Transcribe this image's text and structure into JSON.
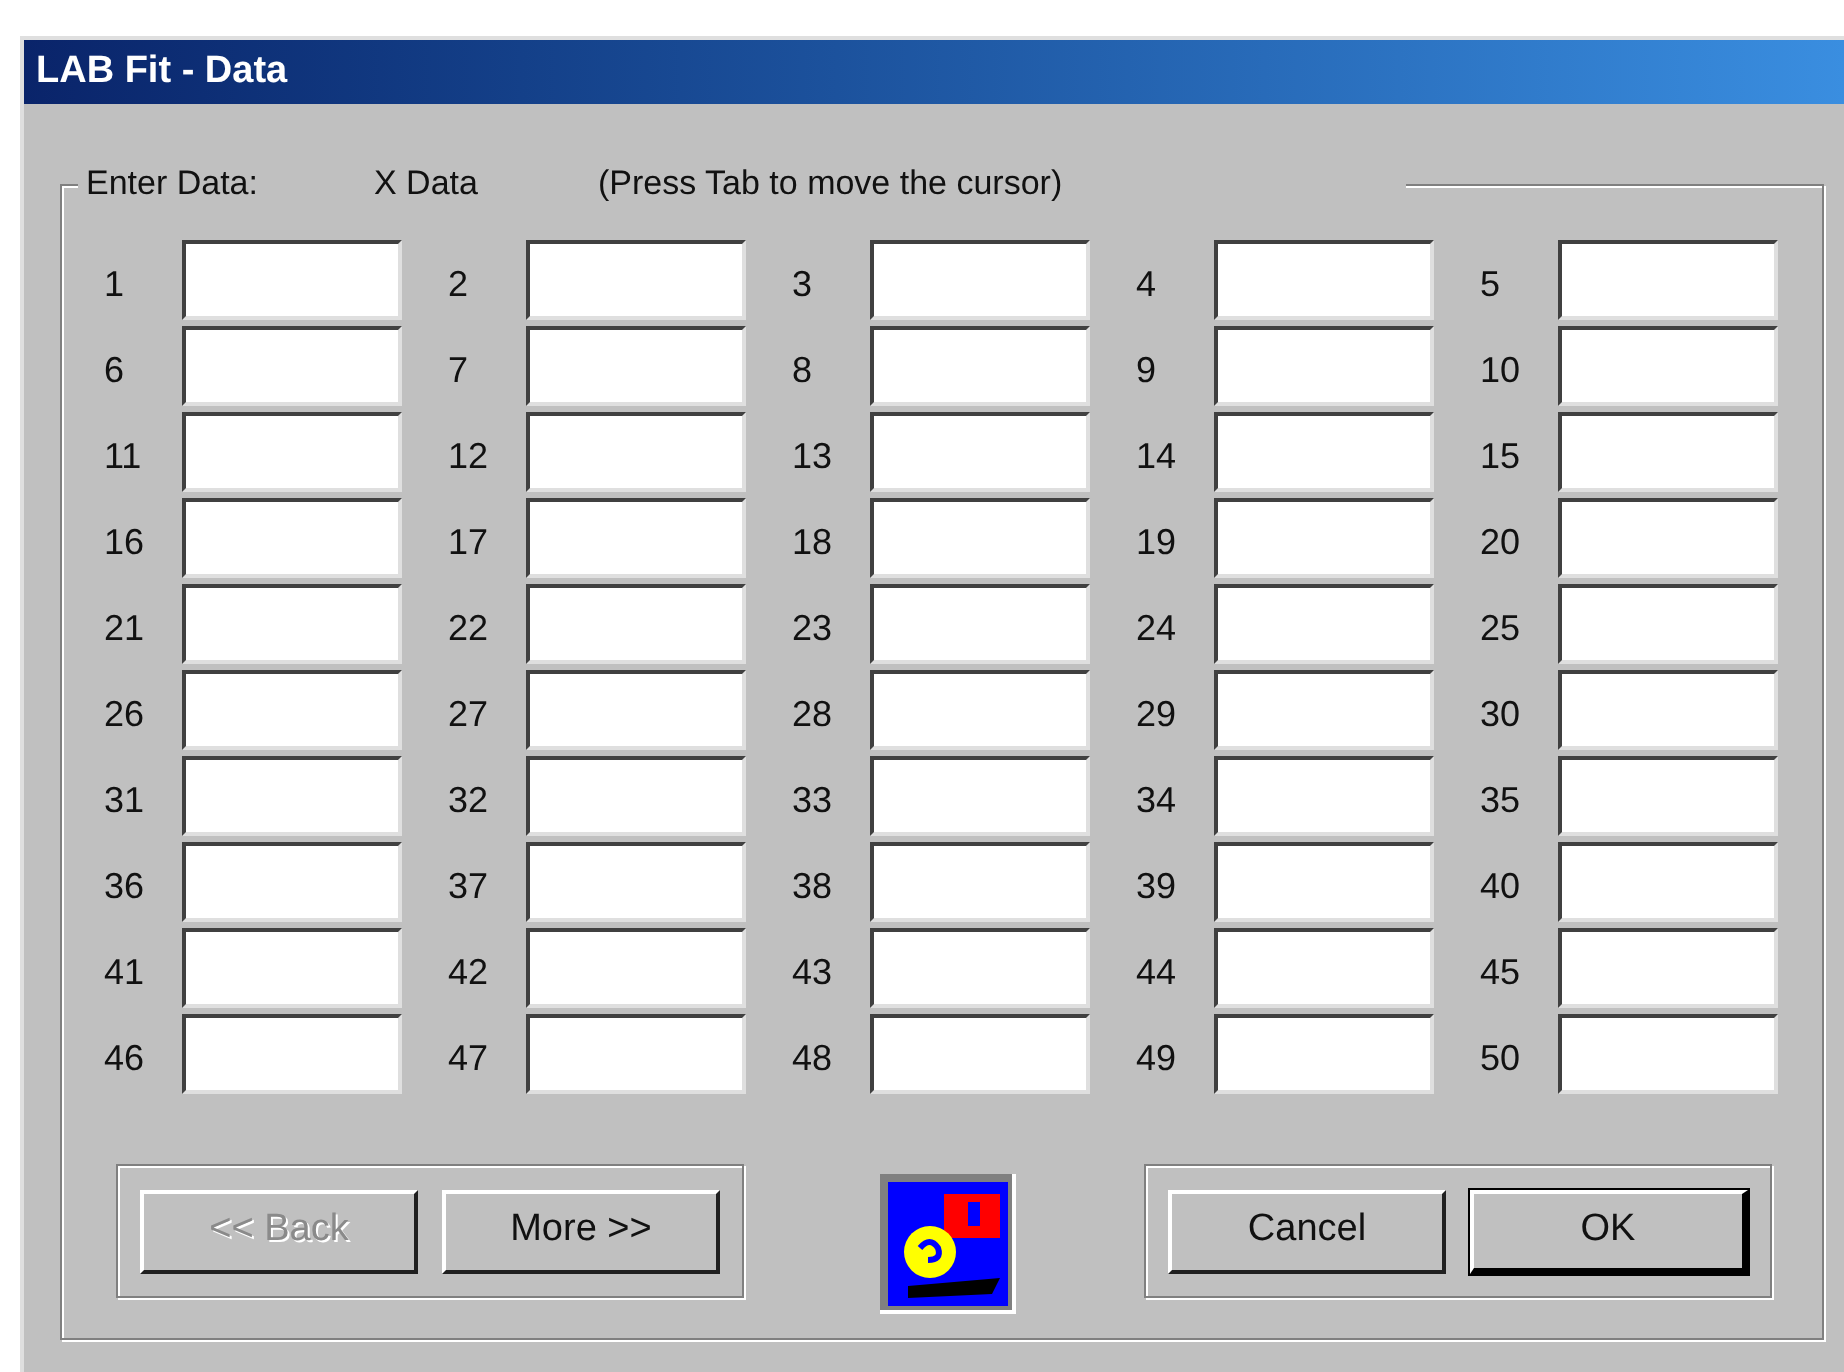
{
  "window": {
    "title": "LAB Fit - Data"
  },
  "group": {
    "label": "Enter Data:",
    "data_kind": "X Data",
    "hint": "(Press Tab to move the cursor)"
  },
  "cells": [
    {
      "label": "1"
    },
    {
      "label": "2"
    },
    {
      "label": "3"
    },
    {
      "label": "4"
    },
    {
      "label": "5"
    },
    {
      "label": "6"
    },
    {
      "label": "7"
    },
    {
      "label": "8"
    },
    {
      "label": "9"
    },
    {
      "label": "10"
    },
    {
      "label": "11"
    },
    {
      "label": "12"
    },
    {
      "label": "13"
    },
    {
      "label": "14"
    },
    {
      "label": "15"
    },
    {
      "label": "16"
    },
    {
      "label": "17"
    },
    {
      "label": "18"
    },
    {
      "label": "19"
    },
    {
      "label": "20"
    },
    {
      "label": "21"
    },
    {
      "label": "22"
    },
    {
      "label": "23"
    },
    {
      "label": "24"
    },
    {
      "label": "25"
    },
    {
      "label": "26"
    },
    {
      "label": "27"
    },
    {
      "label": "28"
    },
    {
      "label": "29"
    },
    {
      "label": "30"
    },
    {
      "label": "31"
    },
    {
      "label": "32"
    },
    {
      "label": "33"
    },
    {
      "label": "34"
    },
    {
      "label": "35"
    },
    {
      "label": "36"
    },
    {
      "label": "37"
    },
    {
      "label": "38"
    },
    {
      "label": "39"
    },
    {
      "label": "40"
    },
    {
      "label": "41"
    },
    {
      "label": "42"
    },
    {
      "label": "43"
    },
    {
      "label": "44"
    },
    {
      "label": "45"
    },
    {
      "label": "46"
    },
    {
      "label": "47"
    },
    {
      "label": "48"
    },
    {
      "label": "49"
    },
    {
      "label": "50"
    }
  ],
  "nav_buttons": [
    {
      "label": "<< Back",
      "disabled": true,
      "default": false
    },
    {
      "label": "More >>",
      "disabled": false,
      "default": false
    }
  ],
  "action_buttons": [
    {
      "label": "Cancel",
      "disabled": false,
      "default": false
    },
    {
      "label": "OK",
      "disabled": false,
      "default": true
    }
  ]
}
